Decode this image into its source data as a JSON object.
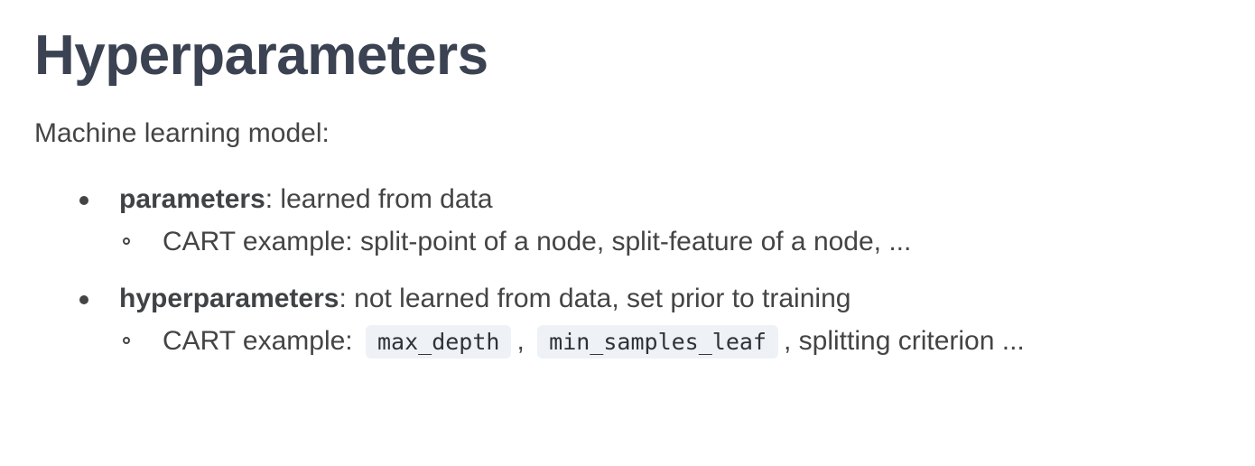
{
  "title": "Hyperparameters",
  "intro": "Machine learning model:",
  "items": [
    {
      "term": "parameters",
      "description": ": learned from data",
      "sub": {
        "text": "CART example: split-point of a node, split-feature of a node, ..."
      }
    },
    {
      "term": "hyperparameters",
      "description": ": not learned from data, set prior to training",
      "sub": {
        "prefix": "CART example:",
        "code1": "max_depth",
        "separator": ",",
        "code2": "min_samples_leaf",
        "suffix": ", splitting criterion ..."
      }
    }
  ]
}
